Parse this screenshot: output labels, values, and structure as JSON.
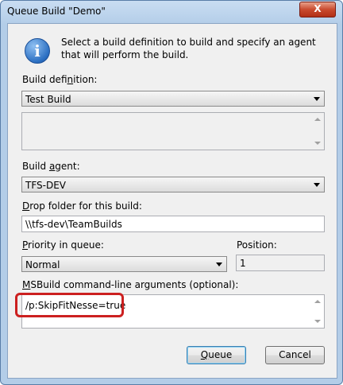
{
  "window": {
    "title": "Queue Build \"Demo\"",
    "close_label": "X"
  },
  "intro": {
    "icon": "info-icon",
    "text": "Select a build definition to build and specify an agent that will perform the build."
  },
  "build_definition": {
    "label_pre": "Build defi",
    "label_key": "n",
    "label_post": "ition:",
    "value": "Test Build"
  },
  "build_agent": {
    "label_pre": "Build ",
    "label_key": "a",
    "label_post": "gent:",
    "value": "TFS-DEV"
  },
  "drop_folder": {
    "label_key": "D",
    "label_post": "rop folder for this build:",
    "value": "\\\\tfs-dev\\TeamBuilds"
  },
  "priority": {
    "label_pre": "",
    "label_key": "P",
    "label_post": "riority in queue:",
    "value": "Normal"
  },
  "position": {
    "label": "Position:",
    "value": "1"
  },
  "msbuild": {
    "label_key": "M",
    "label_post": "SBuild command-line arguments (optional):",
    "value": "/p:SkipFitNesse=true"
  },
  "buttons": {
    "queue_key": "Q",
    "queue_rest": "ueue",
    "cancel": "Cancel"
  }
}
